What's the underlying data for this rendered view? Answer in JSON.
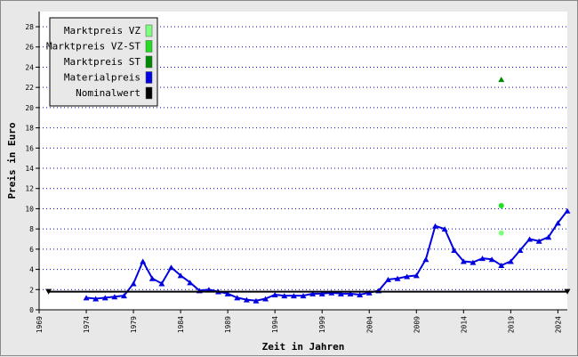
{
  "chart_data": {
    "type": "line",
    "xlabel": "Zeit in Jahren",
    "ylabel": "Preis in Euro",
    "xlim": [
      1969,
      2025
    ],
    "ylim": [
      0,
      29.5
    ],
    "x_ticks": [
      1969,
      1974,
      1979,
      1984,
      1989,
      1994,
      1999,
      2004,
      2009,
      2014,
      2019,
      2024
    ],
    "y_ticks": [
      0,
      2,
      4,
      6,
      8,
      10,
      12,
      14,
      16,
      18,
      20,
      22,
      24,
      26,
      28
    ],
    "grid": "horizontal dotted",
    "legend_position": "top-left",
    "series": [
      {
        "name": "Marktpreis VZ",
        "color": "#7fff7f",
        "marker": "circle",
        "x": [
          2018
        ],
        "y": [
          7.6
        ]
      },
      {
        "name": "Marktpreis VZ-ST",
        "color": "#22dd22",
        "marker": "circle",
        "x": [
          2018
        ],
        "y": [
          10.3
        ]
      },
      {
        "name": "Marktpreis ST",
        "color": "#008800",
        "marker": "triangle",
        "x": [
          2018
        ],
        "y": [
          22.8
        ]
      },
      {
        "name": "Materialpreis",
        "color": "#0000e0",
        "marker": "triangle",
        "x": [
          1974,
          1975,
          1976,
          1977,
          1978,
          1979,
          1980,
          1981,
          1982,
          1983,
          1984,
          1985,
          1986,
          1987,
          1988,
          1989,
          1990,
          1991,
          1992,
          1993,
          1994,
          1995,
          1996,
          1997,
          1998,
          1999,
          2000,
          2001,
          2002,
          2003,
          2004,
          2005,
          2006,
          2007,
          2008,
          2009,
          2010,
          2011,
          2012,
          2013,
          2014,
          2015,
          2016,
          2017,
          2018,
          2019,
          2020,
          2021,
          2022,
          2023,
          2024,
          2025
        ],
        "y": [
          1.2,
          1.1,
          1.2,
          1.3,
          1.4,
          2.6,
          4.8,
          3.1,
          2.6,
          4.2,
          3.4,
          2.7,
          1.9,
          2.0,
          1.8,
          1.6,
          1.2,
          1.0,
          0.9,
          1.1,
          1.5,
          1.4,
          1.4,
          1.4,
          1.6,
          1.6,
          1.7,
          1.6,
          1.6,
          1.5,
          1.7,
          1.9,
          3.0,
          3.1,
          3.3,
          3.4,
          5.0,
          8.3,
          8.0,
          5.9,
          4.8,
          4.7,
          5.1,
          5.0,
          4.4,
          4.8,
          5.9,
          7.0,
          6.8,
          7.2,
          8.6,
          9.8
        ]
      },
      {
        "name": "Nominalwert",
        "color": "#000000",
        "marker": "triangle-down",
        "x": [
          1970,
          2025
        ],
        "y": [
          1.79,
          1.79
        ]
      }
    ]
  }
}
